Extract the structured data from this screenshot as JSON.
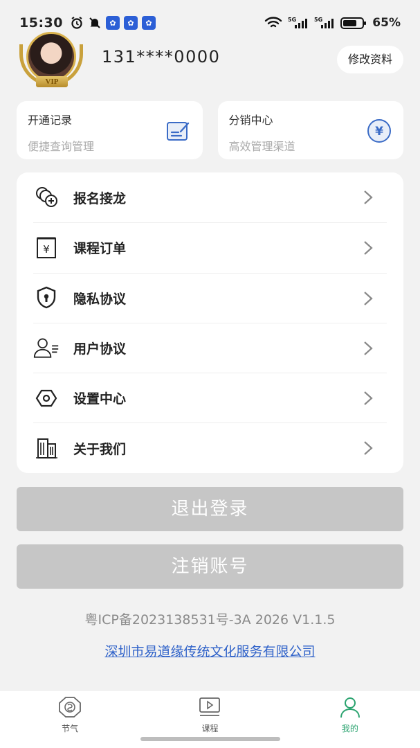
{
  "status_bar": {
    "time": "15:30",
    "battery": "65%",
    "network_1": "5G",
    "network_2": "5G"
  },
  "profile": {
    "vip_label": "VIP",
    "phone": "131****0000",
    "edit_button": "修改资料"
  },
  "quick_cards": [
    {
      "title": "开通记录",
      "subtitle": "便捷查询管理",
      "icon": "edit-note-icon"
    },
    {
      "title": "分销中心",
      "subtitle": "高效管理渠道",
      "icon": "yuan-circle-icon",
      "icon_glyph": "¥"
    }
  ],
  "menu": [
    {
      "label": "报名接龙",
      "icon": "coin-stack-plus-icon"
    },
    {
      "label": "课程订单",
      "icon": "order-receipt-icon"
    },
    {
      "label": "隐私协议",
      "icon": "shield-lock-icon"
    },
    {
      "label": "用户协议",
      "icon": "user-list-icon"
    },
    {
      "label": "设置中心",
      "icon": "settings-hex-icon"
    },
    {
      "label": "关于我们",
      "icon": "building-icon"
    }
  ],
  "buttons": {
    "logout": "退出登录",
    "deregister": "注销账号"
  },
  "footer": {
    "icp": "粤ICP备2023138531号-3A  2026   V1.1.5",
    "company": "深圳市易道缘传统文化服务有限公司"
  },
  "tabbar": [
    {
      "label": "节气",
      "icon": "solar-term-icon",
      "active": false
    },
    {
      "label": "课程",
      "icon": "video-course-icon",
      "active": false
    },
    {
      "label": "我的",
      "icon": "profile-icon",
      "active": true
    }
  ],
  "colors": {
    "accent_green": "#2aa36f",
    "link_blue": "#2f62c9",
    "button_gray": "#c6c6c6",
    "background": "#f2f2f2"
  }
}
